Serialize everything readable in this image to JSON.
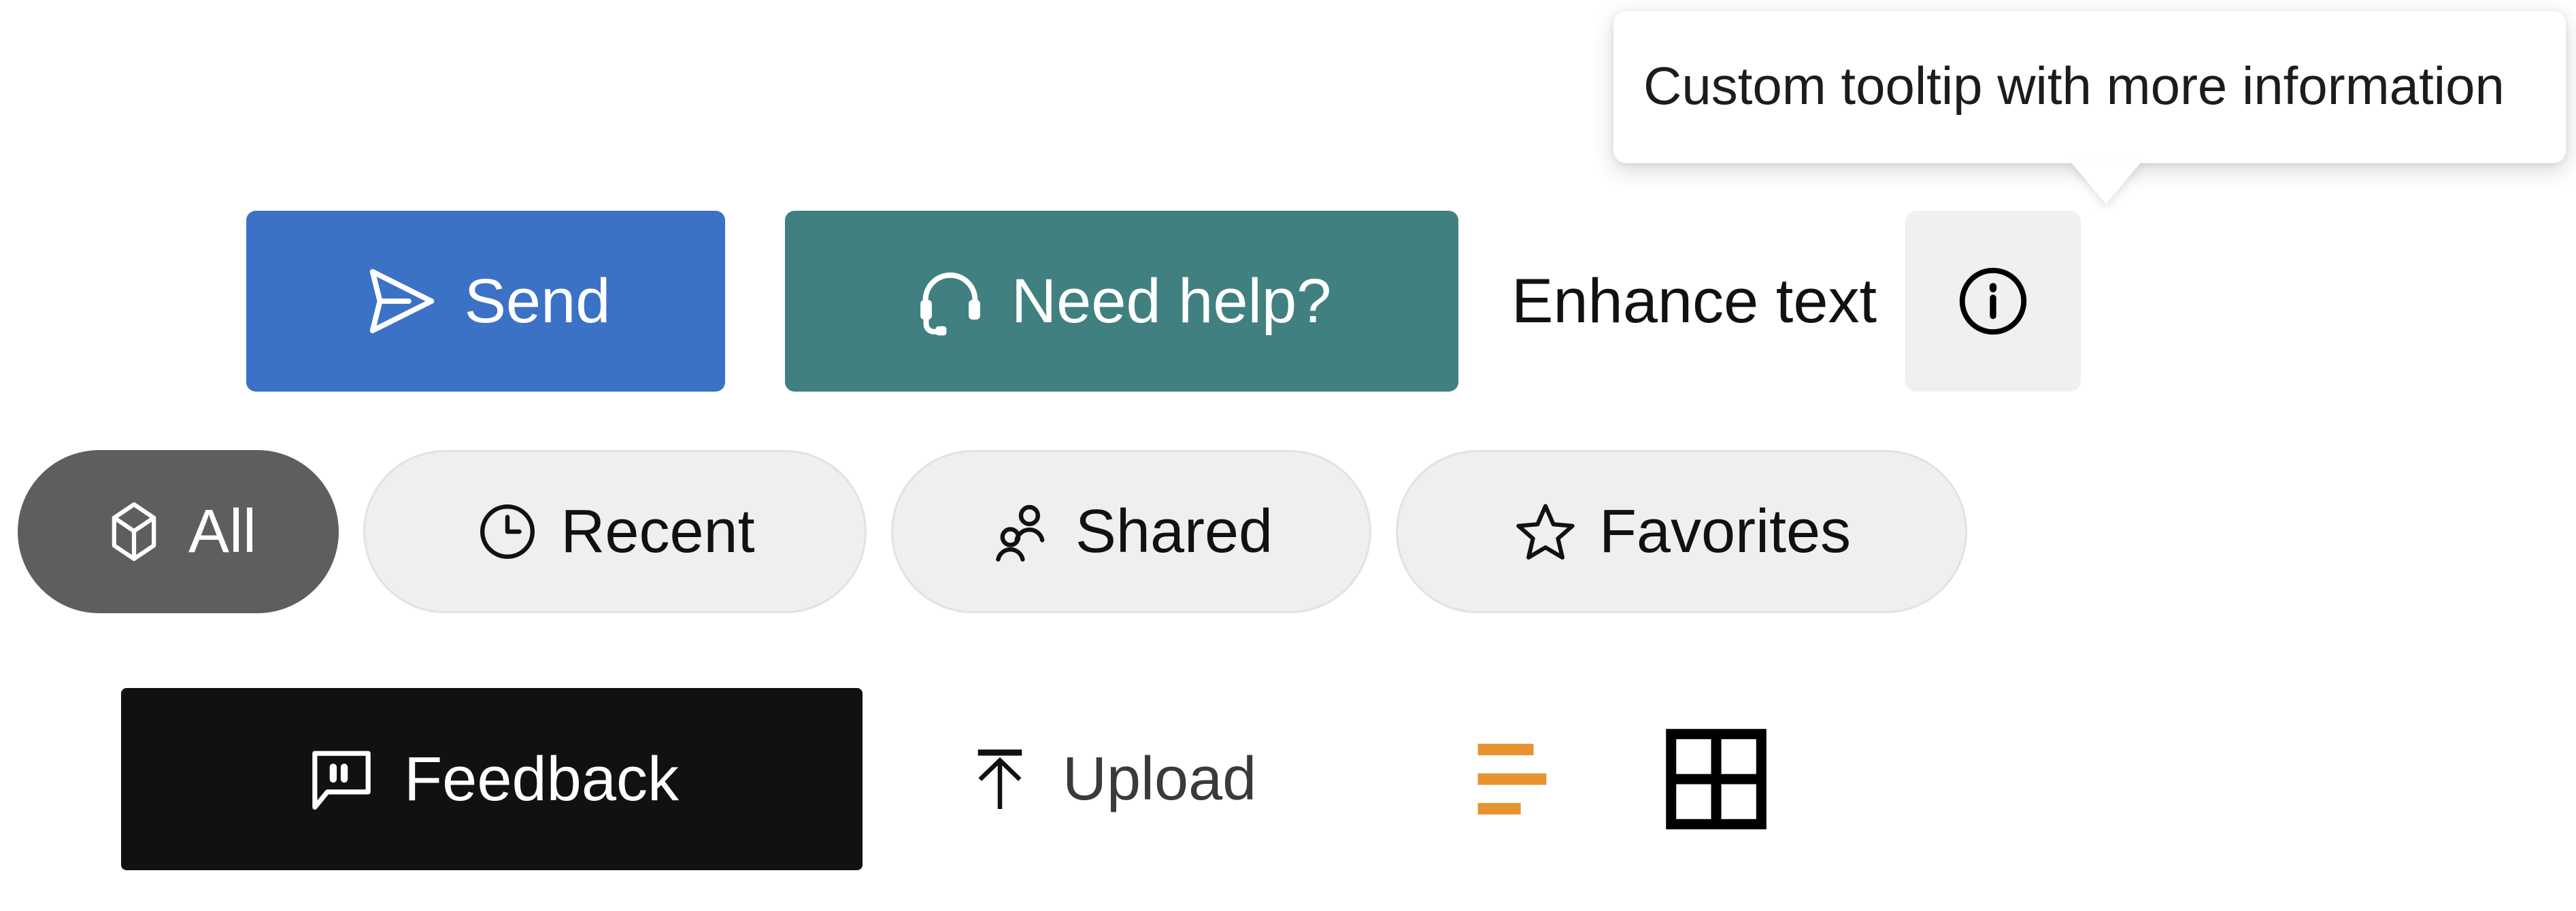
{
  "tooltip": {
    "text": "Custom tooltip with more information",
    "anchor": "info-button",
    "position": "above",
    "background": "#ffffff",
    "text_color": "#1c1c1c"
  },
  "action_row": {
    "send": {
      "label": "Send",
      "icon": "send-icon",
      "background": "#3b72c6",
      "text_color": "#ffffff"
    },
    "help": {
      "label": "Need help?",
      "icon": "headset-icon",
      "background": "#408080",
      "text_color": "#ffffff"
    },
    "enhance": {
      "label": "Enhance text",
      "text_color": "#111111"
    },
    "info": {
      "icon": "info-circle-icon",
      "background": "#f1f0ef",
      "icon_color": "#000000"
    }
  },
  "filter_pills": {
    "items": [
      {
        "label": "All",
        "icon": "cube-icon",
        "selected": true,
        "background": "#5e5e5e",
        "text_color": "#ffffff"
      },
      {
        "label": "Recent",
        "icon": "clock-icon",
        "selected": false,
        "background": "#efefef",
        "text_color": "#111111"
      },
      {
        "label": "Shared",
        "icon": "people-icon",
        "selected": false,
        "background": "#efefef",
        "text_color": "#111111"
      },
      {
        "label": "Favorites",
        "icon": "star-icon",
        "selected": false,
        "background": "#efefef",
        "text_color": "#111111"
      }
    ]
  },
  "utility_row": {
    "feedback": {
      "label": "Feedback",
      "icon": "comment-quote-icon",
      "background": "#111111",
      "text_color": "#ffffff"
    },
    "upload": {
      "label": "Upload",
      "icon": "upload-arrow-icon",
      "text_color": "#3a3a3a"
    },
    "list_view": {
      "icon": "list-view-icon",
      "color": "#e8932f",
      "active": true
    },
    "grid_view": {
      "icon": "grid-view-icon",
      "color": "#000000",
      "active": false
    }
  }
}
